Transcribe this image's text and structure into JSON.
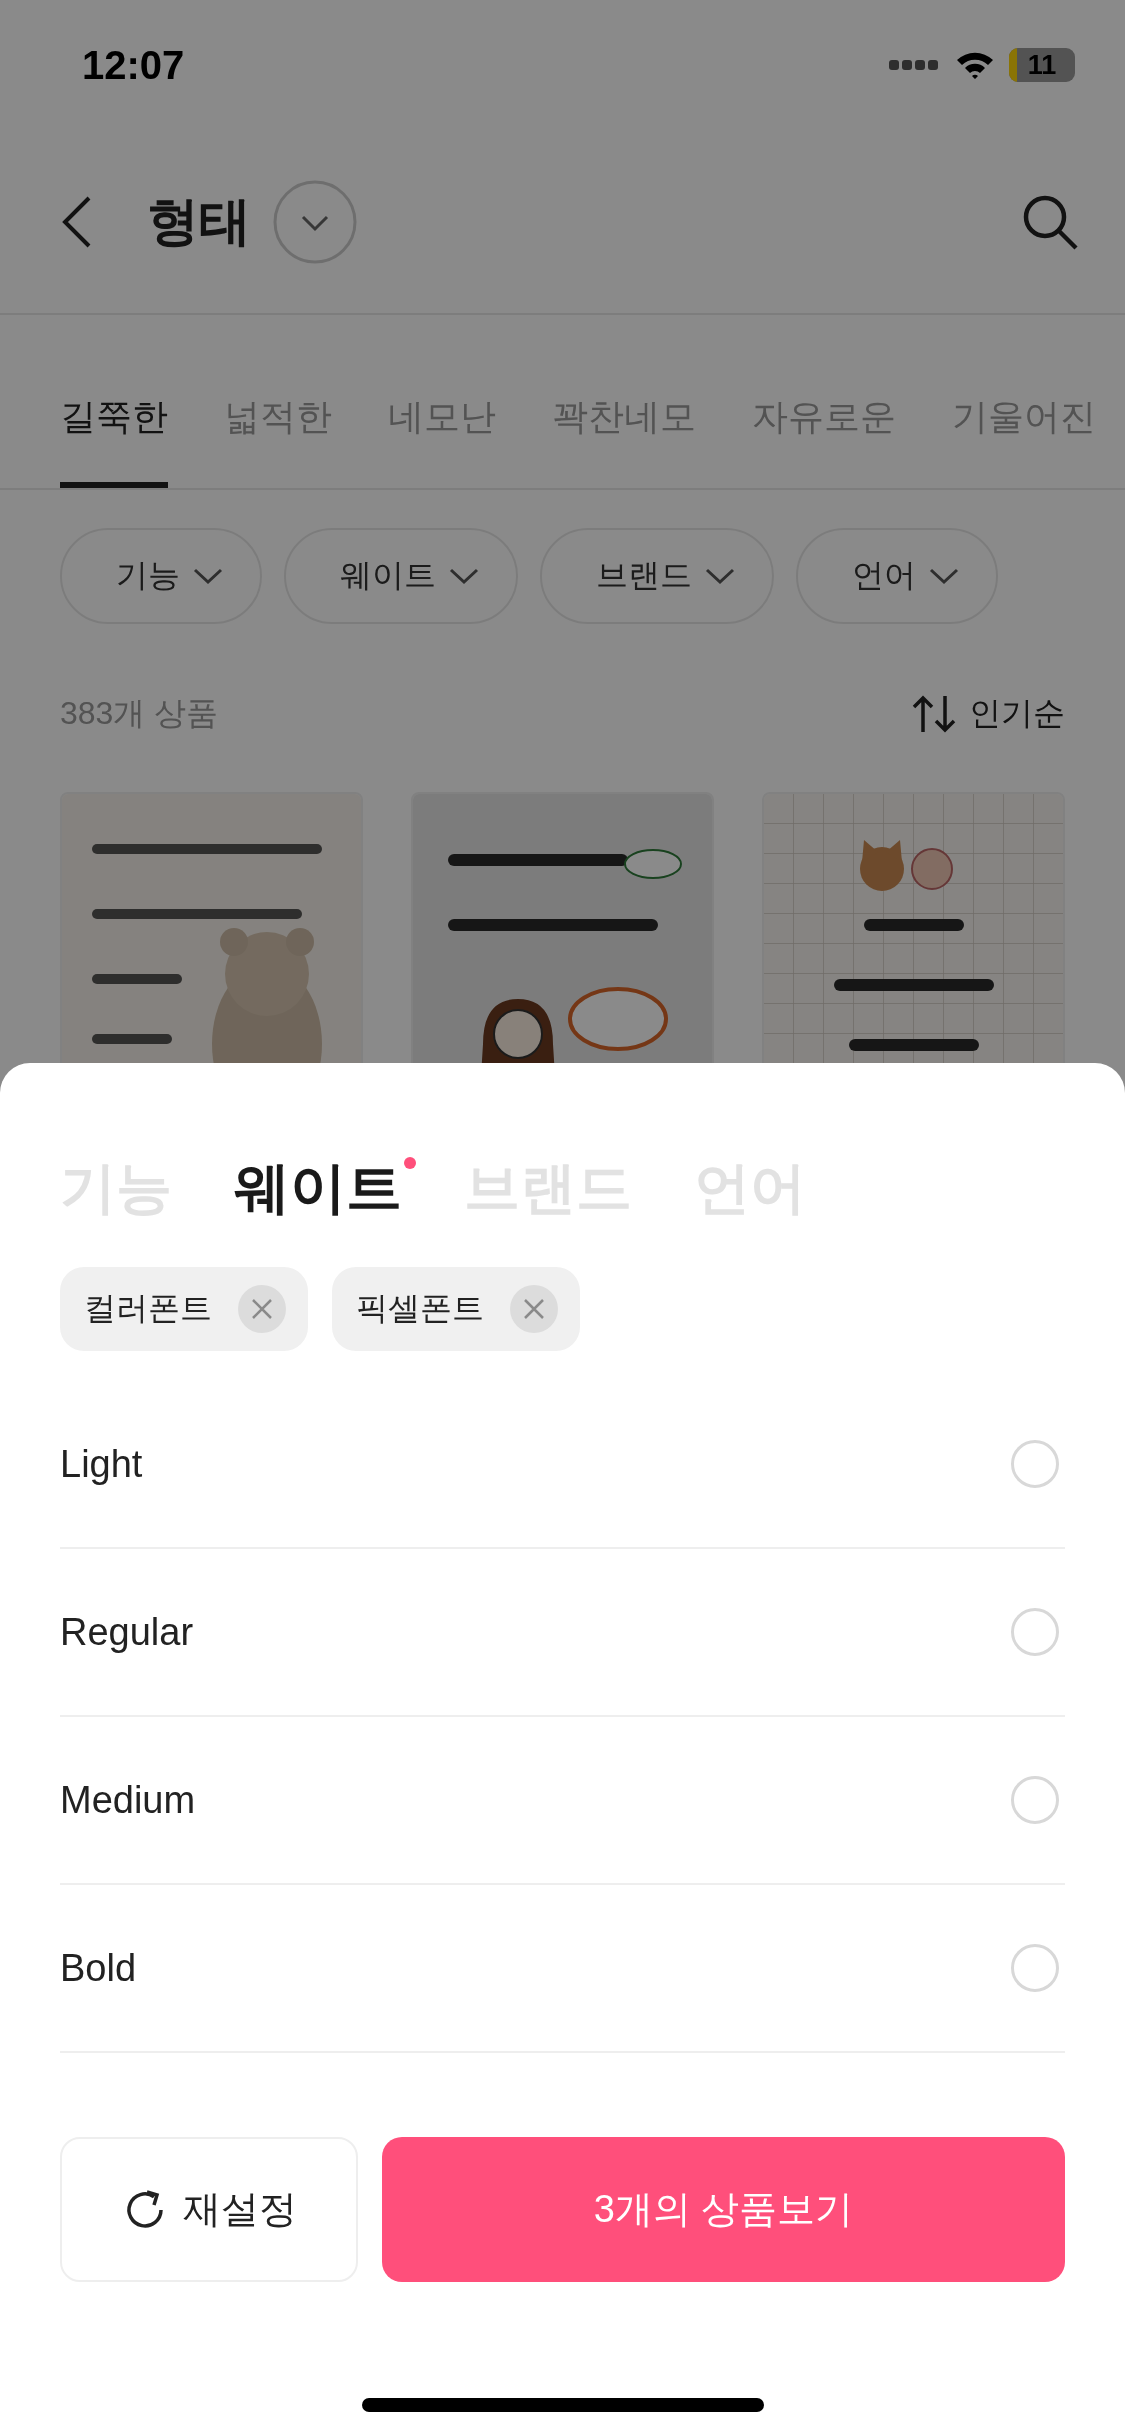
{
  "status_bar": {
    "time": "12:07",
    "battery": "11"
  },
  "header": {
    "title": "형태"
  },
  "tabs": [
    {
      "label": "길쭉한",
      "selected": true
    },
    {
      "label": "넓적한",
      "selected": false
    },
    {
      "label": "네모난",
      "selected": false
    },
    {
      "label": "꽉찬네모",
      "selected": false
    },
    {
      "label": "자유로운",
      "selected": false
    },
    {
      "label": "기울어진",
      "selected": false
    }
  ],
  "filters": [
    {
      "label": "기능"
    },
    {
      "label": "웨이트"
    },
    {
      "label": "브랜드"
    },
    {
      "label": "언어"
    }
  ],
  "result": {
    "count": "383개 상품",
    "sort": "인기순"
  },
  "sheet": {
    "tabs": [
      {
        "label": "기능",
        "selected": false,
        "has_selection": false
      },
      {
        "label": "웨이트",
        "selected": true,
        "has_selection": true
      },
      {
        "label": "브랜드",
        "selected": false,
        "has_selection": false
      },
      {
        "label": "언어",
        "selected": false,
        "has_selection": false
      }
    ],
    "chips": [
      {
        "label": "컬러폰트"
      },
      {
        "label": "픽셀폰트"
      }
    ],
    "options": [
      {
        "label": "Light",
        "checked": false
      },
      {
        "label": "Regular",
        "checked": false
      },
      {
        "label": "Medium",
        "checked": false
      },
      {
        "label": "Bold",
        "checked": false
      }
    ],
    "reset": "재설정",
    "apply": "3개의 상품보기"
  }
}
